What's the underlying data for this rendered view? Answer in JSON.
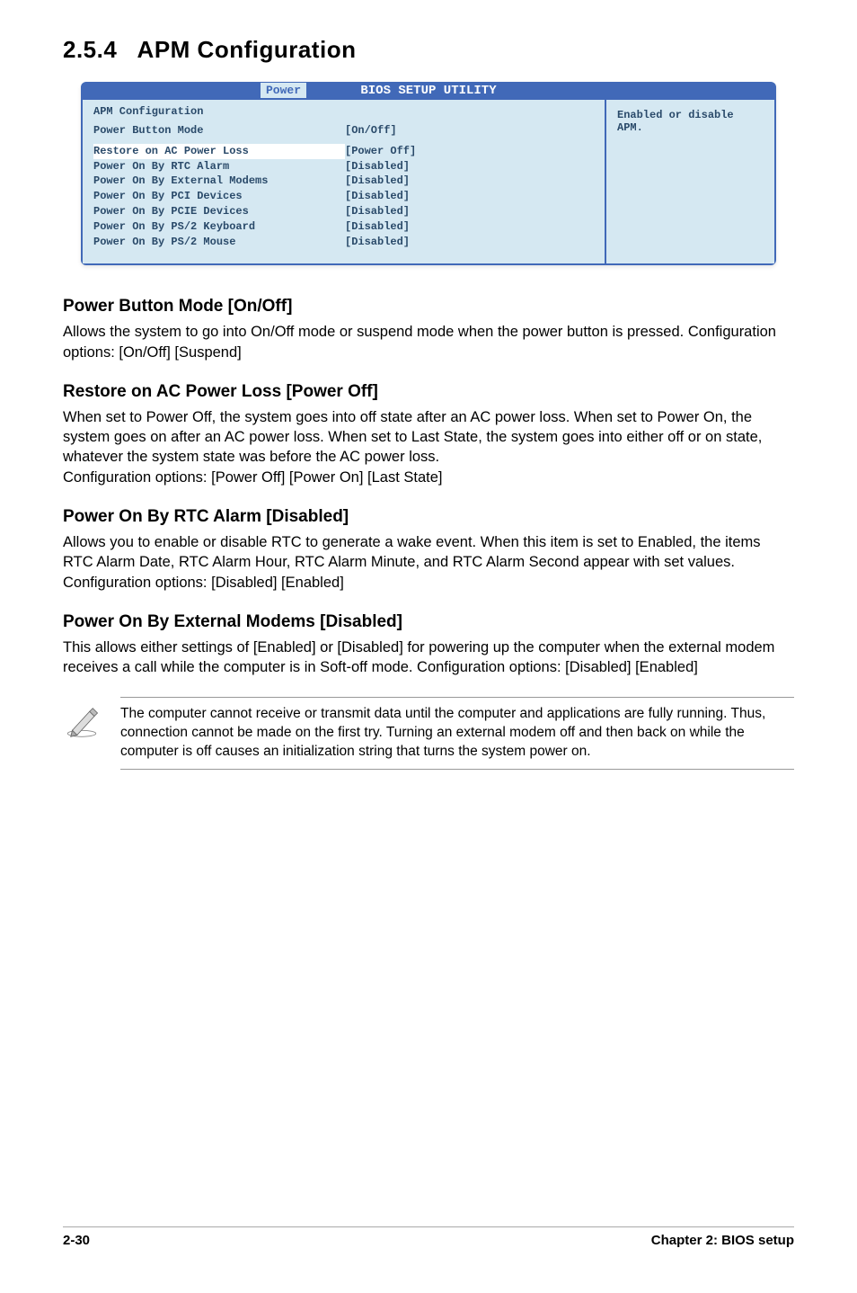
{
  "section": {
    "number": "2.5.4",
    "title": "APM Configuration"
  },
  "bios": {
    "headerTitle": "BIOS SETUP UTILITY",
    "tab": "Power",
    "configHeading": "APM Configuration",
    "help": "Enabled or disable APM.",
    "rows": [
      {
        "label": "Power Button Mode",
        "value": "[On/Off]",
        "spacerBefore": false
      },
      {
        "label": "Restore on AC Power Loss",
        "value": "[Power Off]",
        "spacerBefore": true,
        "highlight": true
      },
      {
        "label": "Power On By RTC Alarm",
        "value": "[Disabled]",
        "spacerBefore": false
      },
      {
        "label": "Power On By External Modems",
        "value": "[Disabled]",
        "spacerBefore": false
      },
      {
        "label": "Power On By PCI Devices",
        "value": "[Disabled]",
        "spacerBefore": false
      },
      {
        "label": "Power On By PCIE Devices",
        "value": "[Disabled]",
        "spacerBefore": false
      },
      {
        "label": "Power On By PS/2 Keyboard",
        "value": "[Disabled]",
        "spacerBefore": false
      },
      {
        "label": "Power On By PS/2 Mouse",
        "value": "[Disabled]",
        "spacerBefore": false
      }
    ]
  },
  "subSections": [
    {
      "heading": "Power Button Mode [On/Off]",
      "body": "Allows the system to go into On/Off mode or suspend mode when the power button is pressed. Configuration options: [On/Off] [Suspend]"
    },
    {
      "heading": "Restore on AC Power Loss [Power Off]",
      "body": "When set to Power Off, the system goes into off state after an AC power loss. When set to Power On, the system goes on after an AC power loss. When set to Last State, the system goes into either off or on state, whatever the system state was before the AC power loss.\nConfiguration options: [Power Off] [Power On] [Last State]"
    },
    {
      "heading": "Power On By RTC Alarm [Disabled]",
      "body": "Allows you to enable or disable RTC to generate a wake event. When this item is set to Enabled, the items RTC Alarm Date, RTC Alarm Hour, RTC Alarm Minute, and RTC Alarm Second appear with set values. Configuration options: [Disabled] [Enabled]"
    },
    {
      "heading": "Power On By External Modems [Disabled]",
      "body": "This allows either settings of [Enabled] or [Disabled] for powering up the computer when the external modem receives a call while the computer is in Soft-off mode. Configuration options: [Disabled] [Enabled]"
    }
  ],
  "note": "The computer cannot receive or transmit data until the computer and applications are fully running. Thus, connection cannot be made on the first try. Turning an external modem off and then back on while the computer is off causes an initialization string that turns the system power on.",
  "footer": {
    "pageNum": "2-30",
    "chapter": "Chapter 2: BIOS setup"
  }
}
